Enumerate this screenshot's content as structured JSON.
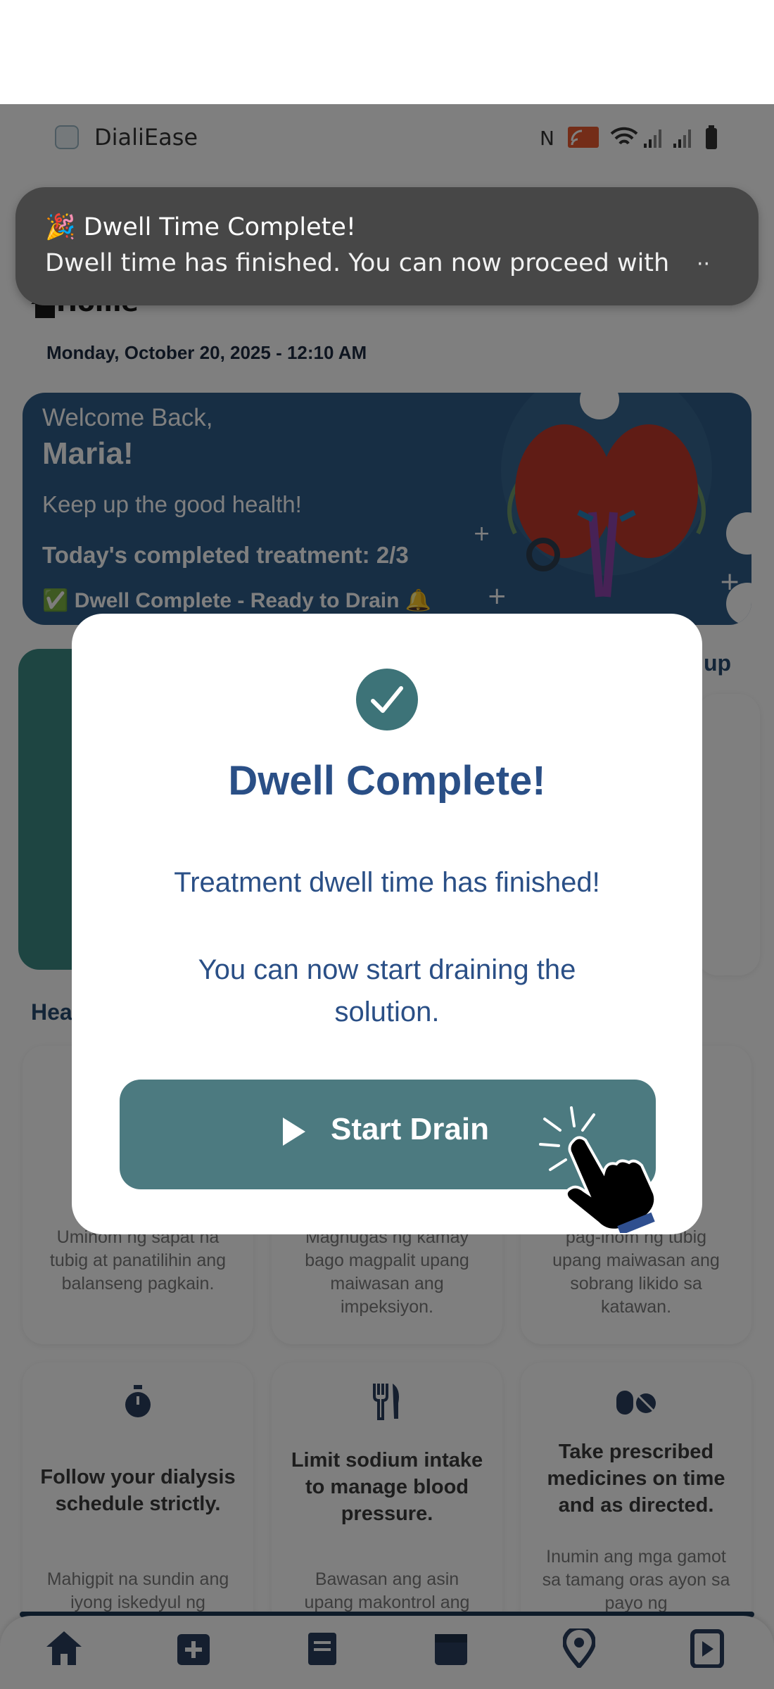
{
  "status_bar": {
    "app_name": "DialiEase"
  },
  "notification": {
    "emoji": "🎉",
    "title": "Dwell Time Complete!",
    "text": "Dwell time has finished. You can now proceed with",
    "more": "··"
  },
  "header": {
    "title": "Home",
    "date": "Monday, October 20, 2025 - 12:10 AM"
  },
  "welcome": {
    "greeting": "Welcome Back,",
    "name": "Maria!",
    "tagline": "Keep up the good health!",
    "treatment": "Today's completed treatment: 2/3",
    "status": "✅ Dwell Complete - Ready to Drain 🔔"
  },
  "partial": {
    "right_label": "up",
    "health_heading": "Hea"
  },
  "tips_row1": [
    {
      "sub": "Uminom ng sapat na tubig at panatilihin ang balanseng pagkain."
    },
    {
      "sub": "Maghugas ng kamay bago magpalit upang maiwasan ang impeksiyon."
    },
    {
      "sub": "pag-inom ng tubig upang maiwasan ang sobrang likido sa katawan."
    }
  ],
  "tips_row2": [
    {
      "icon": "stopwatch-icon",
      "title": "Follow your dialysis schedule strictly.",
      "sub": "Mahigpit na sundin ang iyong iskedyul ng"
    },
    {
      "icon": "utensils-icon",
      "title": "Limit sodium intake to manage blood pressure.",
      "sub": "Bawasan ang asin upang makontrol ang"
    },
    {
      "icon": "pills-icon",
      "title": "Take prescribed medicines on time and as directed.",
      "sub": "Inumin ang mga gamot sa tamang oras ayon sa payo ng"
    }
  ],
  "bottom_nav": {
    "items": [
      "home-icon",
      "medical-kit-icon",
      "documents-icon",
      "calendar-icon",
      "location-icon",
      "video-icon"
    ]
  },
  "modal": {
    "title": "Dwell Complete!",
    "message": "Treatment dwell time has finished!",
    "instruction": "You can now start draining the solution.",
    "button_label": "Start Drain"
  },
  "colors": {
    "primary": "#2a4f86",
    "button": "#4c7a80",
    "check": "#3d7378",
    "card": "#2f5c88"
  }
}
